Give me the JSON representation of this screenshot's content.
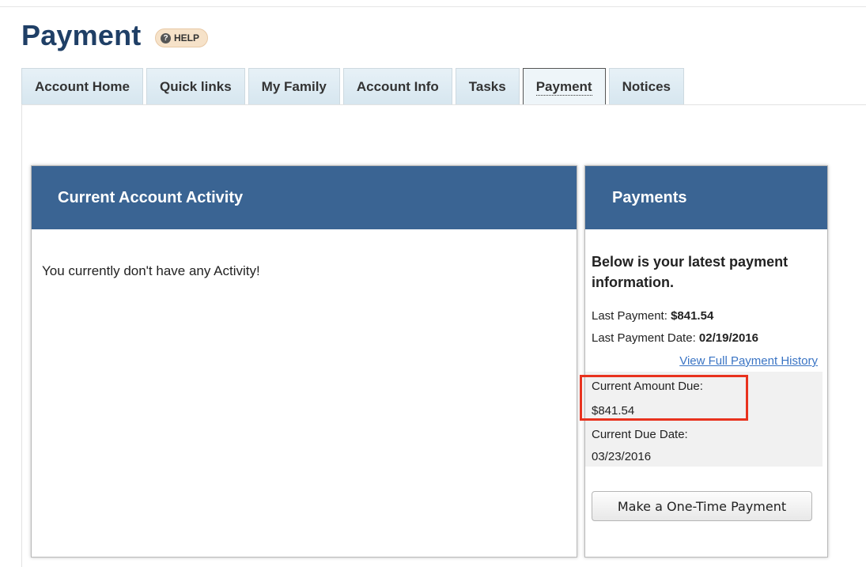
{
  "page": {
    "title": "Payment",
    "help_label": "HELP"
  },
  "tabs": [
    {
      "label": "Account Home",
      "active": false
    },
    {
      "label": "Quick links",
      "active": false
    },
    {
      "label": "My Family",
      "active": false
    },
    {
      "label": "Account Info",
      "active": false
    },
    {
      "label": "Tasks",
      "active": false
    },
    {
      "label": "Payment",
      "active": true
    },
    {
      "label": "Notices",
      "active": false
    }
  ],
  "activity": {
    "header": "Current Account Activity",
    "message": "You currently don't have any Activity!"
  },
  "payments": {
    "header": "Payments",
    "intro": "Below is your latest payment information.",
    "last_payment_label": "Last Payment:",
    "last_payment_value": "$841.54",
    "last_payment_date_label": "Last Payment Date:",
    "last_payment_date_value": "02/19/2016",
    "history_link": "View Full Payment History",
    "current_amount_due_label": "Current Amount Due:",
    "current_amount_due_value": "$841.54",
    "current_due_date_label": "Current Due Date:",
    "current_due_date_value": "03/23/2016",
    "pay_button": "Make a One-Time Payment"
  },
  "colors": {
    "title": "#1f3f66",
    "panel_header": "#3a6493",
    "link": "#3a74c4",
    "highlight": "#e8321e"
  }
}
